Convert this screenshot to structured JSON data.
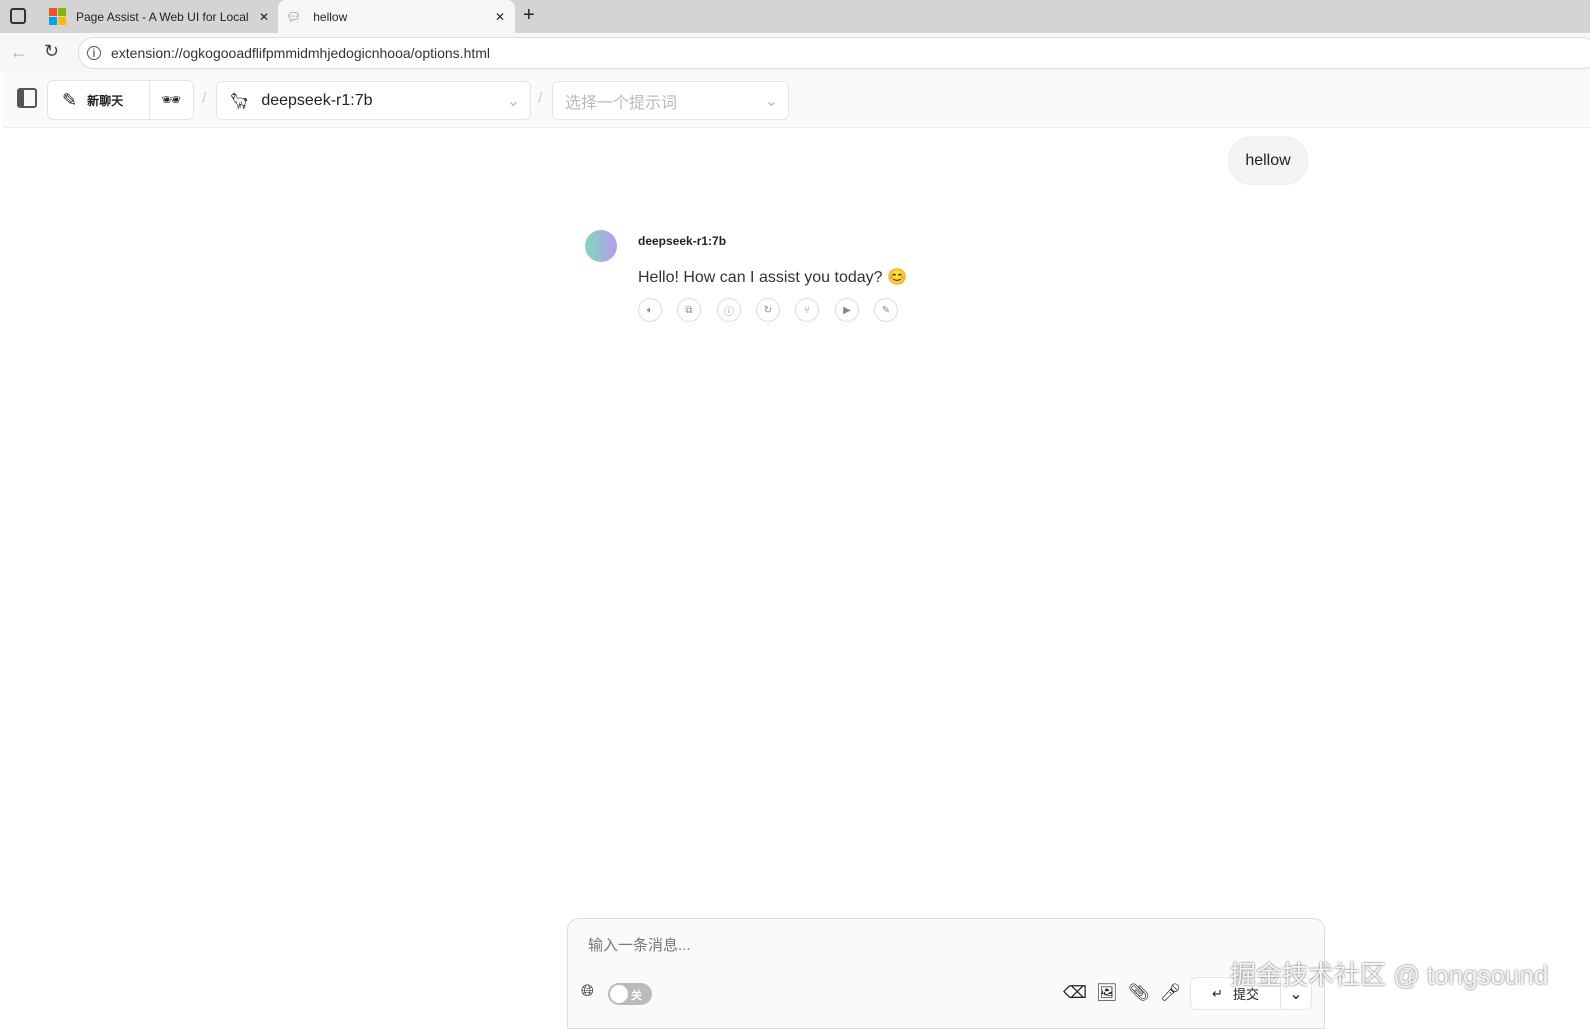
{
  "browser": {
    "tabs": [
      {
        "title": "Page Assist - A Web UI for Local A"
      },
      {
        "title": "hellow"
      }
    ],
    "url": "extension://ogkogooadflifpmmidmhjedogicnhooa/options.html"
  },
  "toolbar": {
    "new_chat": "新聊天",
    "model": "deepseek-r1:7b",
    "prompt_placeholder": "选择一个提示词",
    "separator": "/"
  },
  "chat": {
    "user_message": "hellow",
    "bot_name": "deepseek-r1:7b",
    "bot_message": "Hello! How can I assist you today? 😊"
  },
  "composer": {
    "placeholder": "输入一条消息...",
    "toggle_label": "关",
    "submit": "提交"
  },
  "watermark": "掘金技术社区 @ tongsound"
}
